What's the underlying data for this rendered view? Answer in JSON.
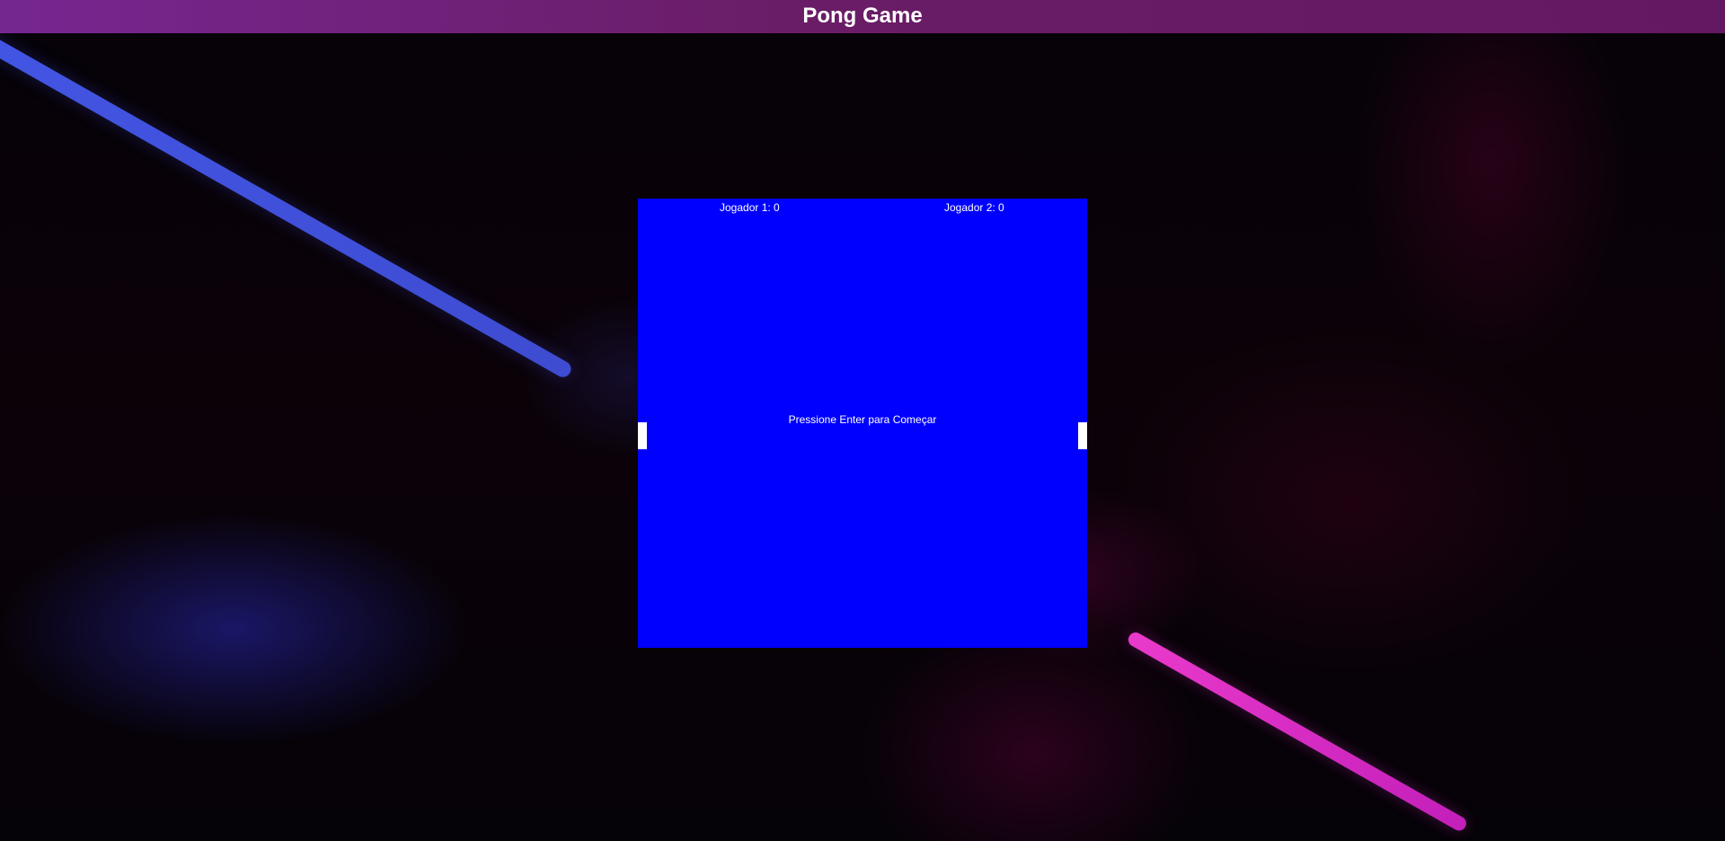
{
  "app": {
    "title": "Pong Game"
  },
  "game": {
    "player1_score_label": "Jogador 1: 0",
    "player2_score_label": "Jogador 2: 0",
    "status_message": "Pressione Enter para Começar"
  },
  "colors": {
    "topbar": "#7a2a7a",
    "board": "#0000ff",
    "paddle": "#ffffff",
    "text": "#ffffff",
    "accent_blue_beam": "#4d5fe8",
    "accent_pink_beam": "#d52bc8"
  }
}
